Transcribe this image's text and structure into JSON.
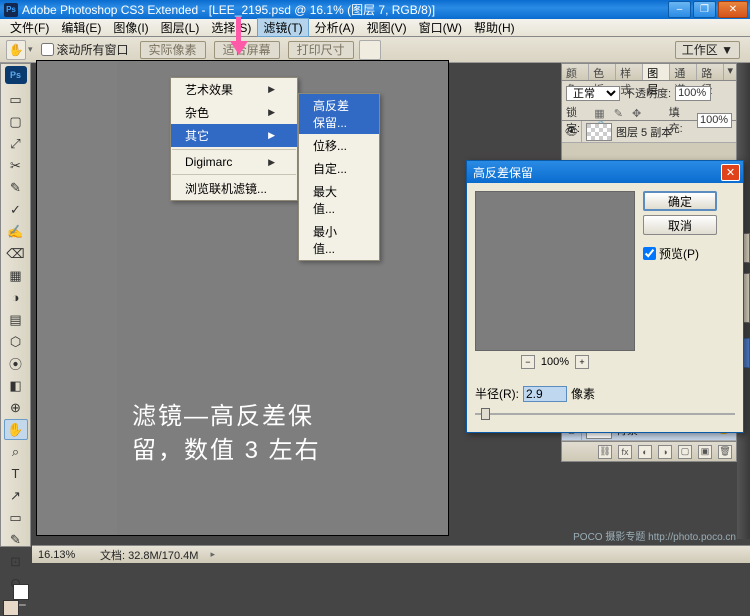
{
  "title": "Adobe Photoshop CS3 Extended - [LEE_2195.psd @ 16.1% (图层 7, RGB/8)]",
  "menubar": [
    "文件(F)",
    "编辑(E)",
    "图像(I)",
    "图层(L)",
    "选择(S)",
    "滤镜(T)",
    "分析(A)",
    "视图(V)",
    "窗口(W)",
    "帮助(H)"
  ],
  "menubar_active_index": 5,
  "options": {
    "scroll_all": "滚动所有窗口",
    "b1": "实际像素",
    "b2": "适合屏幕",
    "b3": "打印尺寸",
    "workspace": "工作区 ▼"
  },
  "submenu1": [
    {
      "label": "艺术效果",
      "arrow": true
    },
    {
      "label": "杂色",
      "arrow": true
    },
    {
      "label": "其它",
      "arrow": true,
      "hl": true
    },
    {
      "sep": true
    },
    {
      "label": "Digimarc",
      "arrow": true
    },
    {
      "sep": true
    },
    {
      "label": "浏览联机滤镜...",
      "arrow": false
    }
  ],
  "submenu2": [
    {
      "label": "高反差保留...",
      "hl": true
    },
    {
      "label": "位移...",
      "hl": false
    },
    {
      "label": "自定...",
      "hl": false
    },
    {
      "label": "最大值...",
      "hl": false
    },
    {
      "label": "最小值...",
      "hl": false
    }
  ],
  "panel_tabs_top": [
    "颜色",
    "色板",
    "样式",
    "图层",
    "通道",
    "路径"
  ],
  "panel_tabs_top_active": 3,
  "layers_panel": {
    "blend": "正常",
    "opacity_label": "不透明度:",
    "opacity": "100%",
    "lock_label": "锁定:",
    "fill_label": "填充:",
    "fill": "100%",
    "layer1": "图层 5 副本"
  },
  "extra_layer": "背景",
  "dialog": {
    "title": "高反差保留",
    "ok": "确定",
    "cancel": "取消",
    "preview": "预览(P)",
    "zoom": "100%",
    "radius_label": "半径(R):",
    "radius_value": "2.9",
    "unit": "像素"
  },
  "annotation_line1": "滤镜—高反差保",
  "annotation_line2": "留，数值 3 左右",
  "status": {
    "zoom": "16.13%",
    "doc": "文档: 32.8M/170.4M"
  },
  "watermark": "POCO 摄影专题  http://photo.poco.cn",
  "tool_icons": [
    "▭",
    "▢",
    "⤢",
    "✂",
    "✎",
    "✓",
    "✍",
    "⌫",
    "▦",
    "◑",
    "▤",
    "⬡",
    "⦿",
    "◧",
    "⊕",
    "✋",
    "⌕",
    "T",
    "↗",
    "▭",
    "✎",
    "⊡",
    "Q"
  ]
}
